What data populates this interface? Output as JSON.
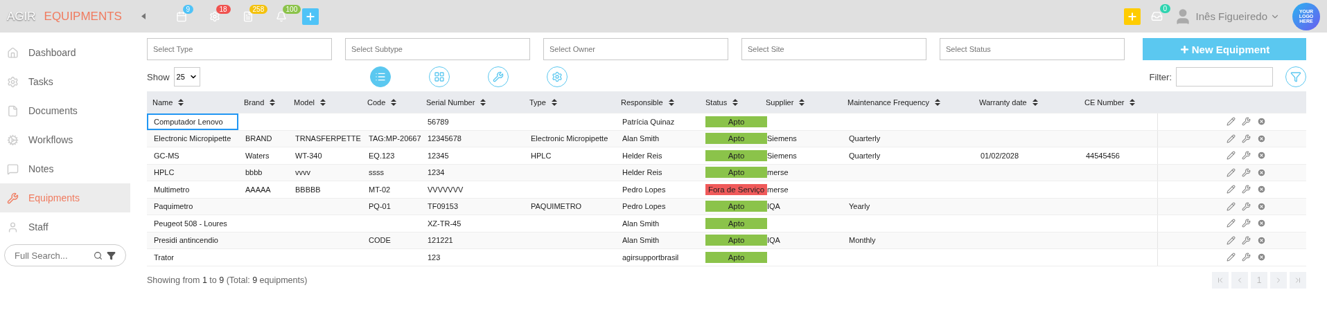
{
  "topbar": {
    "brand": "AGIR",
    "module": "EQUIPMENTS",
    "badges": [
      {
        "kind": "calendar",
        "count": "9",
        "color": "#4fc3f7"
      },
      {
        "kind": "gear",
        "count": "18",
        "color": "#f0524f"
      },
      {
        "kind": "document",
        "count": "258",
        "color": "#f4c20d"
      },
      {
        "kind": "bell",
        "count": "100",
        "color": "#8bc34a"
      }
    ],
    "inbox_count": "0",
    "user": "Inês Figueiredo",
    "logo": "YOUR LOGO HERE"
  },
  "sidebar": {
    "items": [
      {
        "kind": "home",
        "label": "Dashboard",
        "selected": false
      },
      {
        "kind": "gear",
        "label": "Tasks",
        "selected": false
      },
      {
        "kind": "file",
        "label": "Documents",
        "selected": false
      },
      {
        "kind": "gears",
        "label": "Workflows",
        "selected": false
      },
      {
        "kind": "chat",
        "label": "Notes",
        "selected": false
      },
      {
        "kind": "wrench",
        "label": "Equipments",
        "selected": true
      },
      {
        "kind": "user",
        "label": "Staff",
        "selected": false
      }
    ],
    "search": {
      "placeholder": "Full Search..."
    }
  },
  "filters": [
    {
      "placeholder": "Select Type"
    },
    {
      "placeholder": "Select Subtype"
    },
    {
      "placeholder": "Select Owner"
    },
    {
      "placeholder": "Select Site"
    },
    {
      "placeholder": "Select Status"
    }
  ],
  "new_button": "New Equipment",
  "show": {
    "label": "Show",
    "value": "25"
  },
  "views": [
    {
      "kind": "list",
      "selected": true
    },
    {
      "kind": "grid",
      "selected": false
    },
    {
      "kind": "wrench",
      "selected": false
    },
    {
      "kind": "gear",
      "selected": false
    }
  ],
  "filter_label": "Filter:",
  "table": {
    "columns": [
      "Name",
      "Brand",
      "Model",
      "Code",
      "Serial Number",
      "Type",
      "Responsible",
      "Status",
      "Supplier",
      "Maintenance Frequency",
      "Warranty date",
      "CE Number"
    ],
    "rows": [
      {
        "selected": true,
        "cells": [
          "Computador Lenovo",
          "",
          "",
          "",
          "56789",
          "",
          "Patrícia Quinaz",
          "Apto",
          "",
          "",
          "",
          ""
        ],
        "color": "#8bc34a"
      },
      {
        "selected": false,
        "cells": [
          "Electronic Micropipette",
          "BRAND",
          "TRNASFERPETTE",
          "TAG:MP-20667",
          "12345678",
          "Electronic Micropipette",
          "Alan Smith",
          "Apto",
          "Siemens",
          "Quarterly",
          "",
          ""
        ],
        "color": "#8bc34a"
      },
      {
        "selected": false,
        "cells": [
          "GC-MS",
          "Waters",
          "WT-340",
          "EQ.123",
          "12345",
          "HPLC",
          "Helder Reis",
          "Apto",
          "Siemens",
          "Quarterly",
          "01/02/2028",
          "44545456"
        ],
        "color": "#8bc34a"
      },
      {
        "selected": false,
        "cells": [
          "HPLC",
          "bbbb",
          "vvvv",
          "ssss",
          "1234",
          "",
          "Helder Reis",
          "Apto",
          "merse",
          "",
          "",
          ""
        ],
        "color": "#8bc34a"
      },
      {
        "selected": false,
        "cells": [
          "Multimetro",
          "AAAAA",
          "BBBBB",
          "MT-02",
          "VVVVVVV",
          "",
          "Pedro Lopes",
          "Fora de Serviço",
          "merse",
          "",
          "",
          ""
        ],
        "color": "#f05a5a"
      },
      {
        "selected": false,
        "cells": [
          "Paquimetro",
          "",
          "",
          "PQ-01",
          "TF09153",
          "PAQUIMETRO",
          "Pedro Lopes",
          "Apto",
          "IQA",
          "Yearly",
          "",
          ""
        ],
        "color": "#8bc34a"
      },
      {
        "selected": false,
        "cells": [
          "Peugeot 508 - Loures",
          "",
          "",
          "",
          "XZ-TR-45",
          "",
          "Alan Smith",
          "Apto",
          "",
          "",
          "",
          ""
        ],
        "color": "#8bc34a"
      },
      {
        "selected": false,
        "cells": [
          "Presidi antincendio",
          "",
          "",
          "CODE",
          "121221",
          "",
          "Alan Smith",
          "Apto",
          "IQA",
          "Monthly",
          "",
          ""
        ],
        "color": "#8bc34a"
      },
      {
        "selected": false,
        "cells": [
          "Trator",
          "",
          "",
          "",
          "123",
          "",
          "agirsupportbrasil",
          "Apto",
          "",
          "",
          "",
          ""
        ],
        "color": "#8bc34a"
      }
    ]
  },
  "footer": "Showing from **1** to **9** (Total: **9** equipments)",
  "pagination": {
    "page": "1"
  }
}
